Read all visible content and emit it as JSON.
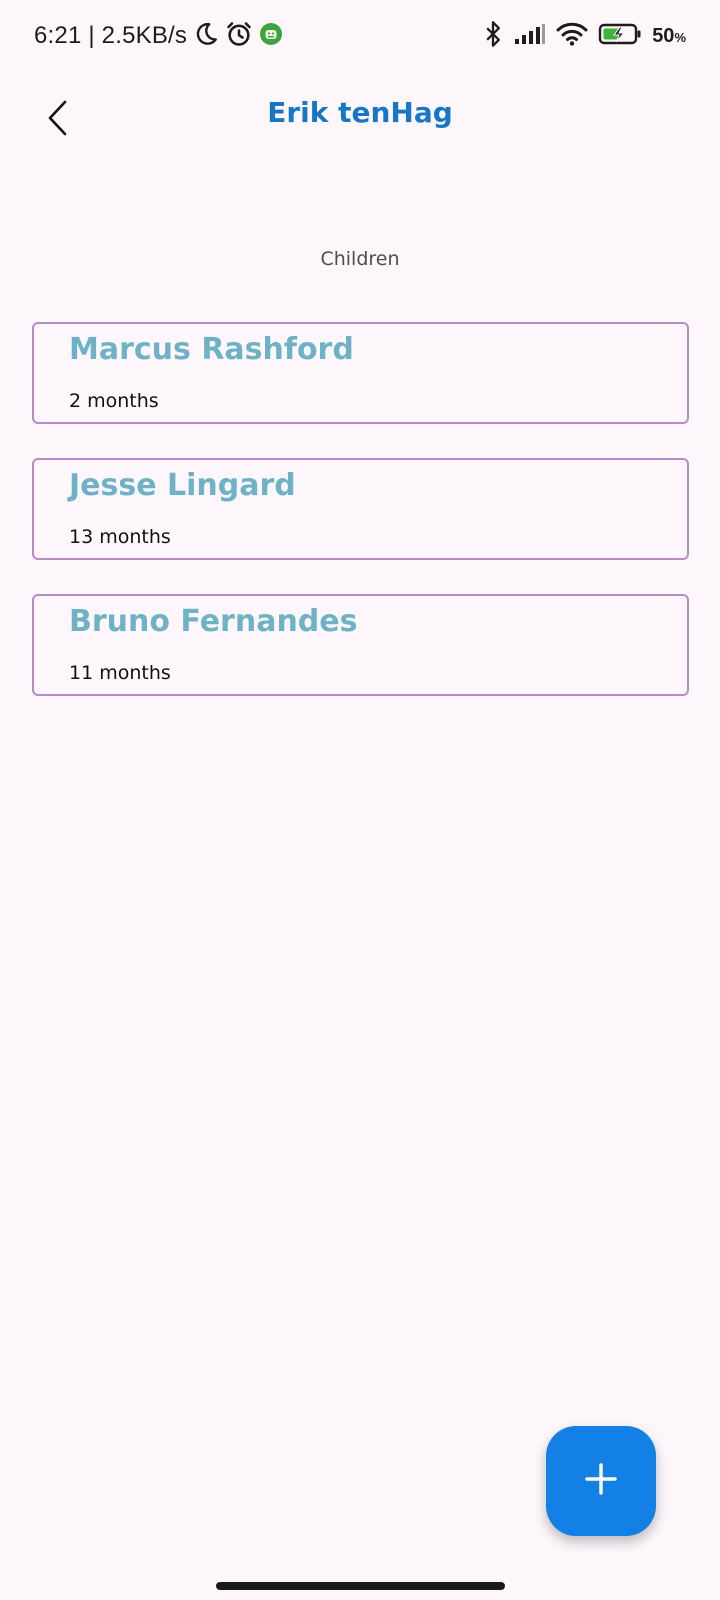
{
  "status_bar": {
    "time_speed": "6:21 | 2.5KB/s",
    "battery_value": "50",
    "battery_unit": "%",
    "icons": [
      "moon-icon",
      "alarm-icon",
      "android-notification-icon",
      "bluetooth-icon",
      "signal-icon",
      "wifi-icon",
      "battery-charging-icon"
    ]
  },
  "app_bar": {
    "title": "Erik tenHag",
    "back_icon": "chevron-left-icon"
  },
  "section": {
    "label": "Children"
  },
  "children": [
    {
      "name": "Marcus Rashford",
      "age": "2 months"
    },
    {
      "name": "Jesse Lingard",
      "age": "13 months"
    },
    {
      "name": "Bruno Fernandes",
      "age": "11 months"
    }
  ],
  "fab": {
    "icon": "plus-icon"
  },
  "colors": {
    "background": "#fdf7fc",
    "title": "#1776c6",
    "child_name": "#6fb2c6",
    "card_border": "#b98bc6",
    "fab": "#1380e6"
  }
}
